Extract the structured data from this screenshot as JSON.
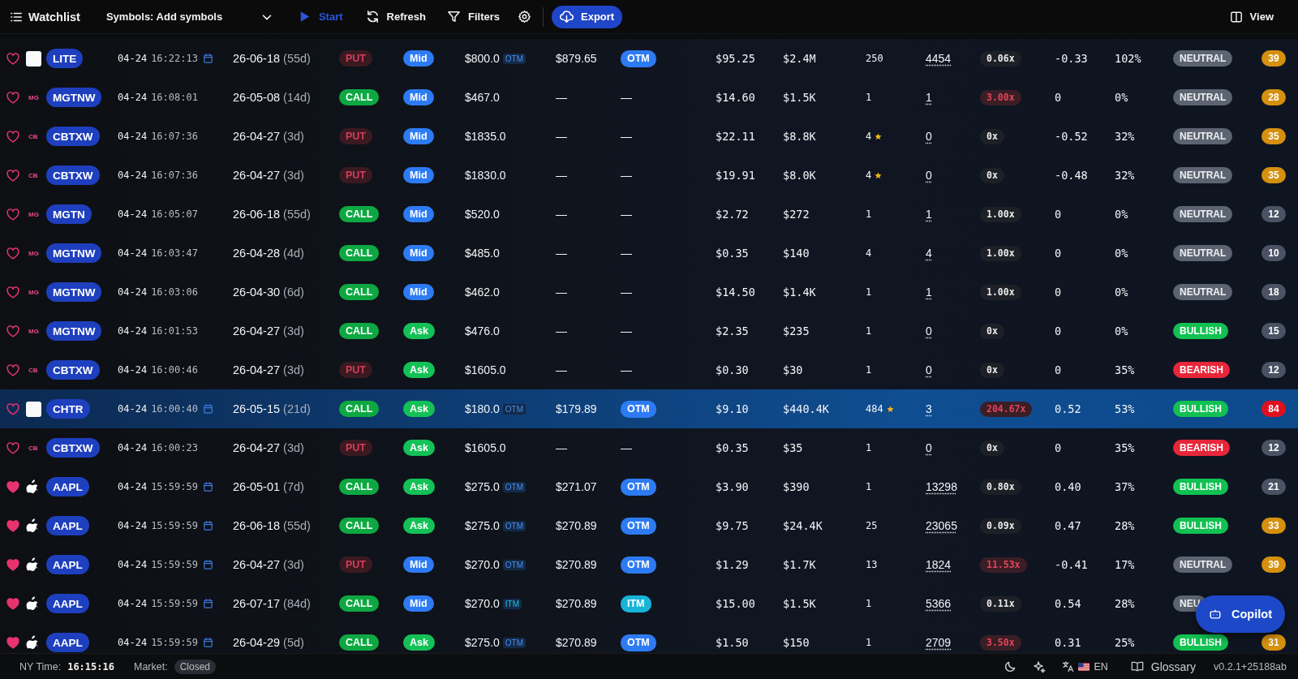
{
  "toolbar": {
    "title": "Watchlist",
    "symbols": "Symbols: Add symbols",
    "actions": [
      {
        "kind": "start",
        "label": "Start"
      },
      {
        "kind": "refresh",
        "label": "Refresh"
      },
      {
        "kind": "filters",
        "label": "Filters"
      },
      {
        "kind": "settings"
      },
      {
        "kind": "export",
        "label": "Export"
      }
    ],
    "view": "View"
  },
  "rows": [
    {
      "favorite": false,
      "selected": false,
      "logo": {
        "kind": "image"
      },
      "ticker": "LITE",
      "date": "04-24",
      "time": "16:22:13",
      "calendar": true,
      "expiry": "26-06-18",
      "dte": "(55d)",
      "type": "PUT",
      "side": {
        "text": "Mid",
        "kind": "mid"
      },
      "strike": "$800.0",
      "strike_tag": {
        "text": "OTM",
        "kind": "otm"
      },
      "price": "$879.65",
      "moneyness": {
        "text": "OTM",
        "kind": "otm"
      },
      "premium": "$95.25",
      "total": "$2.4M",
      "size": "250",
      "star": false,
      "volume": "4454",
      "ratio": {
        "text": "0.06x",
        "alert": false
      },
      "delta": "-0.33",
      "iv": "102%",
      "sentiment": {
        "text": "NEUTRAL",
        "kind": "neutral"
      },
      "score": {
        "text": "39",
        "color": "#d4900e"
      }
    },
    {
      "favorite": false,
      "selected": false,
      "logo": {
        "kind": "text",
        "text": "MG"
      },
      "ticker": "MGTNW",
      "date": "04-24",
      "time": "16:08:01",
      "calendar": false,
      "expiry": "26-05-08",
      "dte": "(14d)",
      "type": "CALL",
      "side": {
        "text": "Mid",
        "kind": "mid"
      },
      "strike": "$467.0",
      "price": "—",
      "moneyness": {
        "text": "—",
        "kind": "none"
      },
      "premium": "$14.60",
      "total": "$1.5K",
      "size": "1",
      "star": false,
      "volume": "1",
      "ratio": {
        "text": "3.00x",
        "alert": true
      },
      "delta": "0",
      "iv": "0%",
      "sentiment": {
        "text": "NEUTRAL",
        "kind": "neutral"
      },
      "score": {
        "text": "28",
        "color": "#d4900e"
      }
    },
    {
      "favorite": false,
      "selected": false,
      "logo": {
        "kind": "text",
        "text": "CB"
      },
      "ticker": "CBTXW",
      "date": "04-24",
      "time": "16:07:36",
      "calendar": false,
      "expiry": "26-04-27",
      "dte": "(3d)",
      "type": "PUT",
      "side": {
        "text": "Mid",
        "kind": "mid"
      },
      "strike": "$1835.0",
      "price": "—",
      "moneyness": {
        "text": "—",
        "kind": "none"
      },
      "premium": "$22.11",
      "total": "$8.8K",
      "size": "4",
      "star": true,
      "volume": "0",
      "ratio": {
        "text": "0x",
        "alert": false
      },
      "delta": "-0.52",
      "iv": "32%",
      "sentiment": {
        "text": "NEUTRAL",
        "kind": "neutral"
      },
      "score": {
        "text": "35",
        "color": "#d4900e"
      }
    },
    {
      "favorite": false,
      "selected": false,
      "logo": {
        "kind": "text",
        "text": "CB"
      },
      "ticker": "CBTXW",
      "date": "04-24",
      "time": "16:07:36",
      "calendar": false,
      "expiry": "26-04-27",
      "dte": "(3d)",
      "type": "PUT",
      "side": {
        "text": "Mid",
        "kind": "mid"
      },
      "strike": "$1830.0",
      "price": "—",
      "moneyness": {
        "text": "—",
        "kind": "none"
      },
      "premium": "$19.91",
      "total": "$8.0K",
      "size": "4",
      "star": true,
      "volume": "0",
      "ratio": {
        "text": "0x",
        "alert": false
      },
      "delta": "-0.48",
      "iv": "32%",
      "sentiment": {
        "text": "NEUTRAL",
        "kind": "neutral"
      },
      "score": {
        "text": "35",
        "color": "#d4900e"
      }
    },
    {
      "favorite": false,
      "selected": false,
      "logo": {
        "kind": "text",
        "text": "MG"
      },
      "ticker": "MGTN",
      "date": "04-24",
      "time": "16:05:07",
      "calendar": false,
      "expiry": "26-06-18",
      "dte": "(55d)",
      "type": "CALL",
      "side": {
        "text": "Mid",
        "kind": "mid"
      },
      "strike": "$520.0",
      "price": "—",
      "moneyness": {
        "text": "—",
        "kind": "none"
      },
      "premium": "$2.72",
      "total": "$272",
      "size": "1",
      "star": false,
      "volume": "1",
      "ratio": {
        "text": "1.00x",
        "alert": false
      },
      "delta": "0",
      "iv": "0%",
      "sentiment": {
        "text": "NEUTRAL",
        "kind": "neutral"
      },
      "score": {
        "text": "12",
        "color": "#4a5263"
      }
    },
    {
      "favorite": false,
      "selected": false,
      "logo": {
        "kind": "text",
        "text": "MG"
      },
      "ticker": "MGTNW",
      "date": "04-24",
      "time": "16:03:47",
      "calendar": false,
      "expiry": "26-04-28",
      "dte": "(4d)",
      "type": "CALL",
      "side": {
        "text": "Mid",
        "kind": "mid"
      },
      "strike": "$485.0",
      "price": "—",
      "moneyness": {
        "text": "—",
        "kind": "none"
      },
      "premium": "$0.35",
      "total": "$140",
      "size": "4",
      "star": false,
      "volume": "4",
      "ratio": {
        "text": "1.00x",
        "alert": false
      },
      "delta": "0",
      "iv": "0%",
      "sentiment": {
        "text": "NEUTRAL",
        "kind": "neutral"
      },
      "score": {
        "text": "10",
        "color": "#4a5263"
      }
    },
    {
      "favorite": false,
      "selected": false,
      "logo": {
        "kind": "text",
        "text": "MG"
      },
      "ticker": "MGTNW",
      "date": "04-24",
      "time": "16:03:06",
      "calendar": false,
      "expiry": "26-04-30",
      "dte": "(6d)",
      "type": "CALL",
      "side": {
        "text": "Mid",
        "kind": "mid"
      },
      "strike": "$462.0",
      "price": "—",
      "moneyness": {
        "text": "—",
        "kind": "none"
      },
      "premium": "$14.50",
      "total": "$1.4K",
      "size": "1",
      "star": false,
      "volume": "1",
      "ratio": {
        "text": "1.00x",
        "alert": false
      },
      "delta": "0",
      "iv": "0%",
      "sentiment": {
        "text": "NEUTRAL",
        "kind": "neutral"
      },
      "score": {
        "text": "18",
        "color": "#4a5263"
      }
    },
    {
      "favorite": false,
      "selected": false,
      "logo": {
        "kind": "text",
        "text": "MG"
      },
      "ticker": "MGTNW",
      "date": "04-24",
      "time": "16:01:53",
      "calendar": false,
      "expiry": "26-04-27",
      "dte": "(3d)",
      "type": "CALL",
      "side": {
        "text": "Ask",
        "kind": "ask"
      },
      "strike": "$476.0",
      "price": "—",
      "moneyness": {
        "text": "—",
        "kind": "none"
      },
      "premium": "$2.35",
      "total": "$235",
      "size": "1",
      "star": false,
      "volume": "0",
      "ratio": {
        "text": "0x",
        "alert": false
      },
      "delta": "0",
      "iv": "0%",
      "sentiment": {
        "text": "BULLISH",
        "kind": "bullish"
      },
      "score": {
        "text": "15",
        "color": "#4a5263"
      }
    },
    {
      "favorite": false,
      "selected": false,
      "logo": {
        "kind": "text",
        "text": "CB"
      },
      "ticker": "CBTXW",
      "date": "04-24",
      "time": "16:00:46",
      "calendar": false,
      "expiry": "26-04-27",
      "dte": "(3d)",
      "type": "PUT",
      "side": {
        "text": "Ask",
        "kind": "ask"
      },
      "strike": "$1605.0",
      "price": "—",
      "moneyness": {
        "text": "—",
        "kind": "none"
      },
      "premium": "$0.30",
      "total": "$30",
      "size": "1",
      "star": false,
      "volume": "0",
      "ratio": {
        "text": "0x",
        "alert": false
      },
      "delta": "0",
      "iv": "35%",
      "sentiment": {
        "text": "BEARISH",
        "kind": "bearish"
      },
      "score": {
        "text": "12",
        "color": "#4a5263"
      }
    },
    {
      "favorite": false,
      "selected": true,
      "logo": {
        "kind": "image"
      },
      "ticker": "CHTR",
      "date": "04-24",
      "time": "16:00:40",
      "calendar": true,
      "expiry": "26-05-15",
      "dte": "(21d)",
      "type": "CALL",
      "side": {
        "text": "Ask",
        "kind": "ask"
      },
      "strike": "$180.0",
      "strike_tag": {
        "text": "OTM",
        "kind": "otm"
      },
      "price": "$179.89",
      "moneyness": {
        "text": "OTM",
        "kind": "otm"
      },
      "premium": "$9.10",
      "total": "$440.4K",
      "size": "484",
      "star": true,
      "volume": "3",
      "ratio": {
        "text": "204.67x",
        "alert": true
      },
      "delta": "0.52",
      "iv": "53%",
      "sentiment": {
        "text": "BULLISH",
        "kind": "bullish"
      },
      "score": {
        "text": "84",
        "color": "#e0101e"
      }
    },
    {
      "favorite": false,
      "selected": false,
      "logo": {
        "kind": "text",
        "text": "CB"
      },
      "ticker": "CBTXW",
      "date": "04-24",
      "time": "16:00:23",
      "calendar": false,
      "expiry": "26-04-27",
      "dte": "(3d)",
      "type": "PUT",
      "side": {
        "text": "Ask",
        "kind": "ask"
      },
      "strike": "$1605.0",
      "price": "—",
      "moneyness": {
        "text": "—",
        "kind": "none"
      },
      "premium": "$0.35",
      "total": "$35",
      "size": "1",
      "star": false,
      "volume": "0",
      "ratio": {
        "text": "0x",
        "alert": false
      },
      "delta": "0",
      "iv": "35%",
      "sentiment": {
        "text": "BEARISH",
        "kind": "bearish"
      },
      "score": {
        "text": "12",
        "color": "#4a5263"
      }
    },
    {
      "favorite": true,
      "selected": false,
      "logo": {
        "kind": "apple"
      },
      "ticker": "AAPL",
      "date": "04-24",
      "time": "15:59:59",
      "calendar": true,
      "expiry": "26-05-01",
      "dte": "(7d)",
      "type": "CALL",
      "side": {
        "text": "Ask",
        "kind": "ask"
      },
      "strike": "$275.0",
      "strike_tag": {
        "text": "OTM",
        "kind": "otm"
      },
      "price": "$271.07",
      "moneyness": {
        "text": "OTM",
        "kind": "otm"
      },
      "premium": "$3.90",
      "total": "$390",
      "size": "1",
      "star": false,
      "volume": "13298",
      "ratio": {
        "text": "0.80x",
        "alert": false
      },
      "delta": "0.40",
      "iv": "37%",
      "sentiment": {
        "text": "BULLISH",
        "kind": "bullish"
      },
      "score": {
        "text": "21",
        "color": "#4a5263"
      }
    },
    {
      "favorite": true,
      "selected": false,
      "logo": {
        "kind": "apple"
      },
      "ticker": "AAPL",
      "date": "04-24",
      "time": "15:59:59",
      "calendar": true,
      "expiry": "26-06-18",
      "dte": "(55d)",
      "type": "CALL",
      "side": {
        "text": "Ask",
        "kind": "ask"
      },
      "strike": "$275.0",
      "strike_tag": {
        "text": "OTM",
        "kind": "otm"
      },
      "price": "$270.89",
      "moneyness": {
        "text": "OTM",
        "kind": "otm"
      },
      "premium": "$9.75",
      "total": "$24.4K",
      "size": "25",
      "star": false,
      "volume": "23065",
      "ratio": {
        "text": "0.09x",
        "alert": false
      },
      "delta": "0.47",
      "iv": "28%",
      "sentiment": {
        "text": "BULLISH",
        "kind": "bullish"
      },
      "score": {
        "text": "33",
        "color": "#d4900e"
      }
    },
    {
      "favorite": true,
      "selected": false,
      "logo": {
        "kind": "apple"
      },
      "ticker": "AAPL",
      "date": "04-24",
      "time": "15:59:59",
      "calendar": true,
      "expiry": "26-04-27",
      "dte": "(3d)",
      "type": "PUT",
      "side": {
        "text": "Mid",
        "kind": "mid"
      },
      "strike": "$270.0",
      "strike_tag": {
        "text": "OTM",
        "kind": "otm"
      },
      "price": "$270.89",
      "moneyness": {
        "text": "OTM",
        "kind": "otm"
      },
      "premium": "$1.29",
      "total": "$1.7K",
      "size": "13",
      "star": false,
      "volume": "1824",
      "ratio": {
        "text": "11.53x",
        "alert": true
      },
      "delta": "-0.41",
      "iv": "17%",
      "sentiment": {
        "text": "NEUTRAL",
        "kind": "neutral"
      },
      "score": {
        "text": "39",
        "color": "#d4900e"
      }
    },
    {
      "favorite": true,
      "selected": false,
      "logo": {
        "kind": "apple"
      },
      "ticker": "AAPL",
      "date": "04-24",
      "time": "15:59:59",
      "calendar": true,
      "expiry": "26-07-17",
      "dte": "(84d)",
      "type": "CALL",
      "side": {
        "text": "Mid",
        "kind": "mid"
      },
      "strike": "$270.0",
      "strike_tag": {
        "text": "ITM",
        "kind": "itm"
      },
      "price": "$270.89",
      "moneyness": {
        "text": "ITM",
        "kind": "itm"
      },
      "premium": "$15.00",
      "total": "$1.5K",
      "size": "1",
      "star": false,
      "volume": "5366",
      "ratio": {
        "text": "0.11x",
        "alert": false
      },
      "delta": "0.54",
      "iv": "28%",
      "sentiment": {
        "text": "NEU",
        "kind": "neutral"
      }
    },
    {
      "favorite": true,
      "selected": false,
      "logo": {
        "kind": "apple"
      },
      "ticker": "AAPL",
      "date": "04-24",
      "time": "15:59:59",
      "calendar": true,
      "expiry": "26-04-29",
      "dte": "(5d)",
      "type": "CALL",
      "side": {
        "text": "Ask",
        "kind": "ask"
      },
      "strike": "$275.0",
      "strike_tag": {
        "text": "OTM",
        "kind": "otm"
      },
      "price": "$270.89",
      "moneyness": {
        "text": "OTM",
        "kind": "otm"
      },
      "premium": "$1.50",
      "total": "$150",
      "size": "1",
      "star": false,
      "volume": "2709",
      "ratio": {
        "text": "3.50x",
        "alert": true
      },
      "delta": "0.31",
      "iv": "25%",
      "sentiment": {
        "text": "BULLISH",
        "kind": "bullish"
      },
      "score": {
        "text": "31",
        "color": "#d4900e"
      }
    }
  ],
  "copilot": "Copilot",
  "status_bar": {
    "ny_time_label": "NY Time:",
    "ny_time": "16:15:16",
    "market_label": "Market:",
    "market_status": "Closed",
    "language": "EN",
    "glossary": "Glossary",
    "version": "v0.2.1+25188ab"
  }
}
